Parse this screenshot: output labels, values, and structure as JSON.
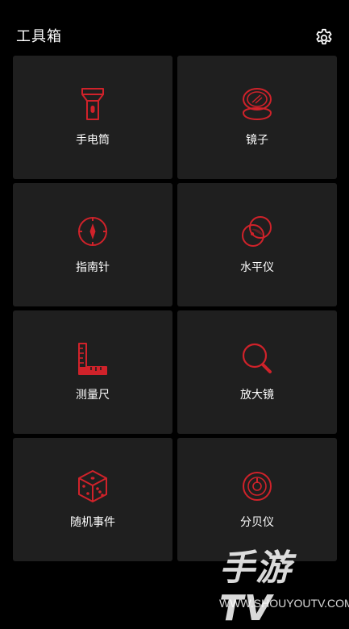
{
  "header": {
    "title": "工具箱",
    "settings_icon": "gear-icon"
  },
  "colors": {
    "background": "#000000",
    "tile": "#1f1f1f",
    "accent": "#d0222a",
    "text": "#ffffff"
  },
  "tools": [
    {
      "label": "手电筒",
      "icon": "flashlight-icon"
    },
    {
      "label": "镜子",
      "icon": "mirror-icon"
    },
    {
      "label": "指南针",
      "icon": "compass-icon"
    },
    {
      "label": "水平仪",
      "icon": "level-icon"
    },
    {
      "label": "测量尺",
      "icon": "ruler-icon"
    },
    {
      "label": "放大镜",
      "icon": "magnifier-icon"
    },
    {
      "label": "随机事件",
      "icon": "dice-icon"
    },
    {
      "label": "分贝仪",
      "icon": "decibel-icon"
    }
  ],
  "watermark": {
    "logo": "手游TV",
    "url": "WWW.SHOUYOUTV.COM"
  }
}
